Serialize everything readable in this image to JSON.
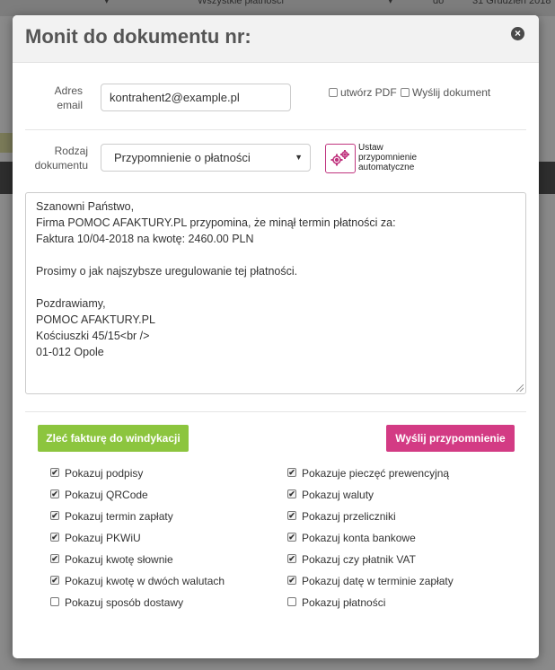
{
  "background": {
    "top_select_1": "▾",
    "top_select_2": "Wszystkie płatności",
    "top_select_2_caret": "▾",
    "top_label_do": "do",
    "top_date": "31 Grudzień 2018"
  },
  "modal": {
    "title": "Monit do dokumentu nr:",
    "close_label": "×",
    "email_label_line1": "Adres",
    "email_label_line2": "email",
    "email_value": "kontrahent2@example.pl",
    "create_pdf_label": "utwórz PDF",
    "send_document_label": "Wyślij dokument",
    "doctype_label_line1": "Rodzaj",
    "doctype_label_line2": "dokumentu",
    "doctype_value": "Przypomnienie o płatności",
    "doctype_caret": "▼",
    "auto_reminder_line1": "Ustaw",
    "auto_reminder_line2": "przypomnienie",
    "auto_reminder_line3": "automatyczne",
    "message_lines": [
      "Szanowni Państwo,",
      "Firma POMOC AFAKTURY.PL przypomina, że minął termin płatności za:",
      "Faktura 10/04-2018 na kwotę: 2460.00 PLN",
      "",
      "Prosimy o jak najszybsze uregulowanie tej płatności.",
      "",
      "Pozdrawiamy,",
      "POMOC AFAKTURY.PL",
      "Kościuszki 45/15<br />",
      "01-012 Opole"
    ],
    "collection_button": "Zleć fakturę do windykacji",
    "send_reminder_button": "Wyślij przypomnienie",
    "left_options": [
      {
        "label": "Pokazuj podpisy",
        "checked": true
      },
      {
        "label": "Pokazuj QRCode",
        "checked": true
      },
      {
        "label": "Pokazuj termin zapłaty",
        "checked": true
      },
      {
        "label": "Pokazuj PKWiU",
        "checked": true
      },
      {
        "label": "Pokazuj kwotę słownie",
        "checked": true
      },
      {
        "label": "Pokazuj kwotę w dwóch walutach",
        "checked": true
      },
      {
        "label": "Pokazuj sposób dostawy",
        "checked": false
      }
    ],
    "right_options": [
      {
        "label": "Pokazuje pieczęć prewencyjną",
        "checked": true
      },
      {
        "label": "Pokazuj waluty",
        "checked": true
      },
      {
        "label": "Pokazuj przeliczniki",
        "checked": true
      },
      {
        "label": "Pokazuj konta bankowe",
        "checked": true
      },
      {
        "label": "Pokazuj czy płatnik VAT",
        "checked": true
      },
      {
        "label": "Pokazuj datę w terminie zapłaty",
        "checked": true
      },
      {
        "label": "Pokazuj płatności",
        "checked": false
      }
    ],
    "check_mark": "✔"
  },
  "colors": {
    "green_button": "#8cc53e",
    "pink_button": "#d33b84",
    "auto_icon": "#c0357f"
  },
  "icons": {
    "close": "close-icon",
    "gears": "gears-icon",
    "checkbox_checked": "checkmark-icon"
  }
}
